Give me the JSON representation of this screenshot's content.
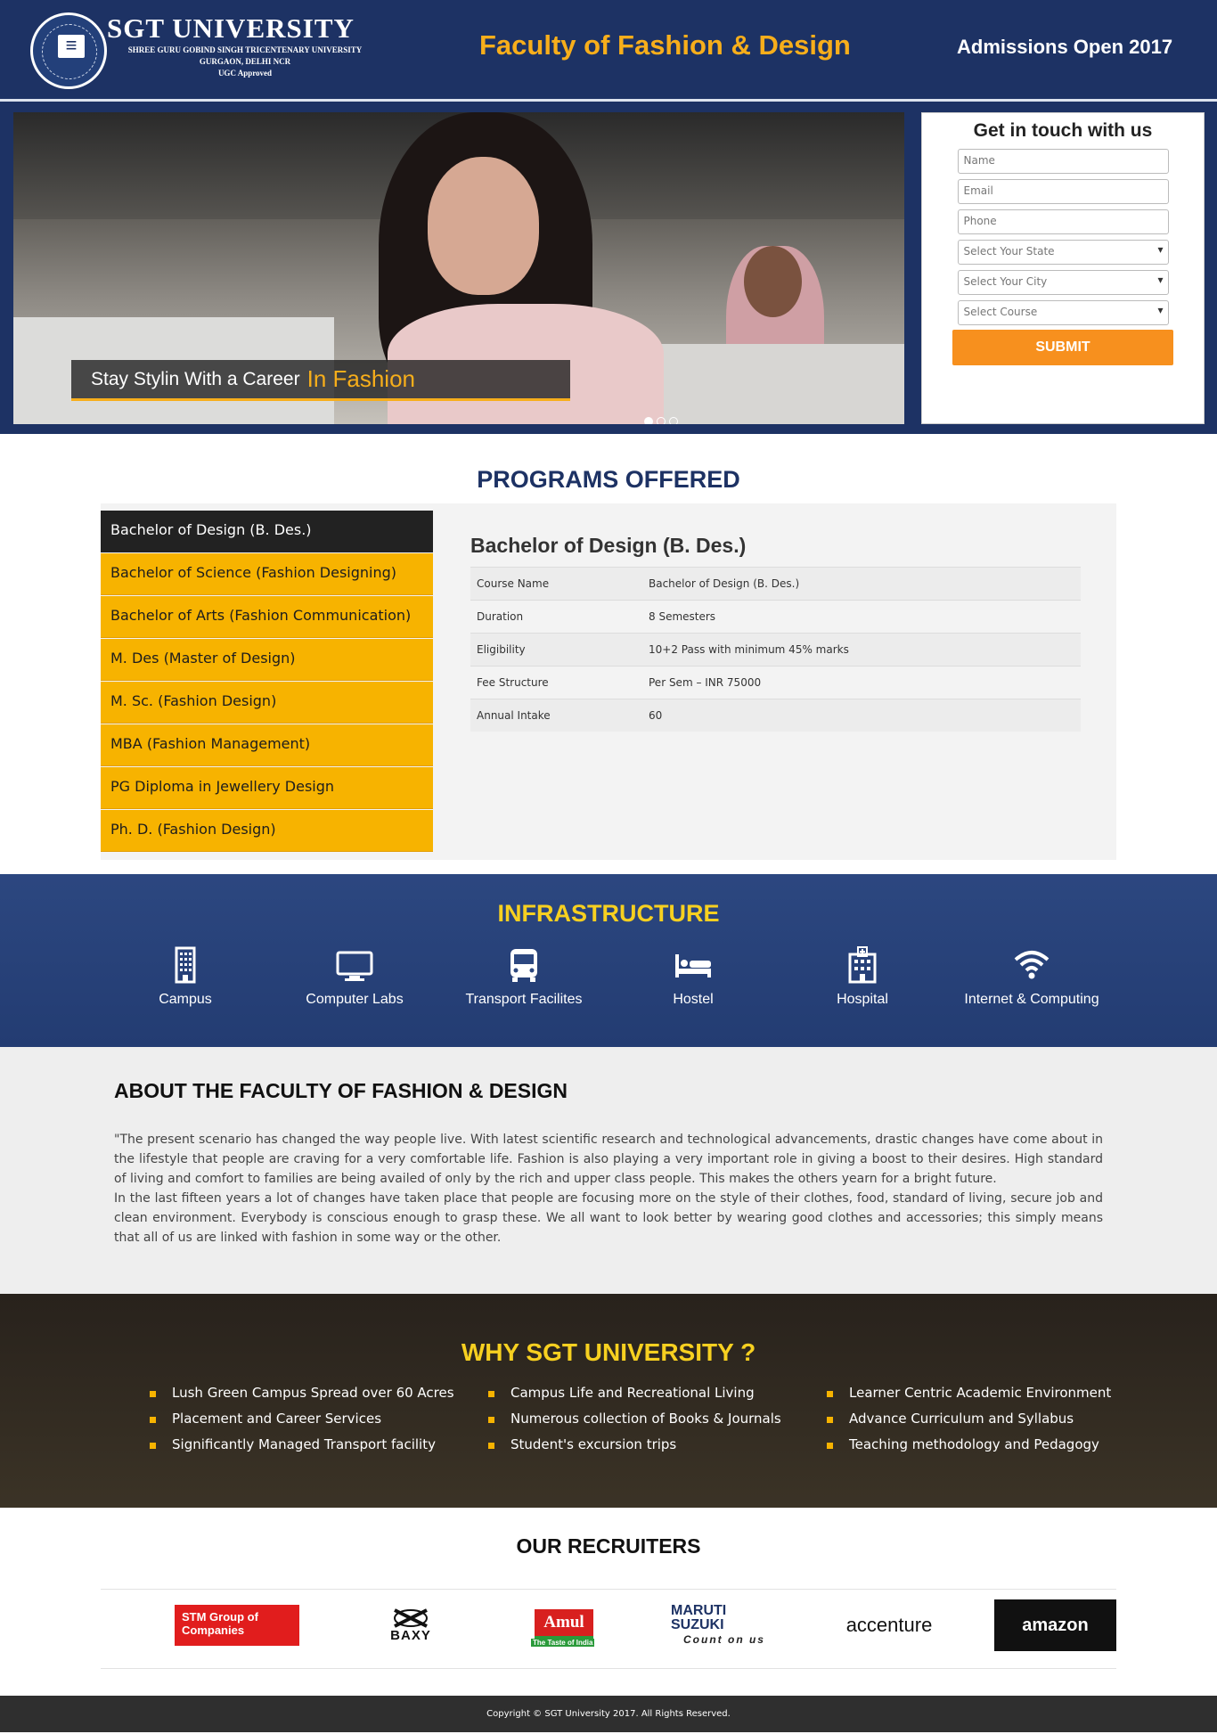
{
  "header": {
    "logo_title": "SGT UNIVERSITY",
    "logo_sub1": "SHREE GURU GOBIND SINGH TRICENTENARY UNIVERSITY",
    "logo_sub2": "GURGAON, DELHI NCR",
    "logo_sub3": "UGC Approved",
    "faculty_title": "Faculty of Fashion & Design",
    "admissions": "Admissions Open 2017"
  },
  "hero": {
    "caption_white": "Stay Stylin With a Career",
    "caption_gold": "In Fashion",
    "active_slide": 1,
    "slide_count": 3
  },
  "form": {
    "title": "Get in touch with us",
    "name_placeholder": "Name",
    "email_placeholder": "Email",
    "phone_placeholder": "Phone",
    "state_select": "Select Your State",
    "city_select": "Select Your City",
    "course_select": "Select Course",
    "submit_label": "SUBMIT"
  },
  "programs": {
    "title": "PROGRAMS OFFERED",
    "items": [
      "Bachelor of Design (B. Des.)",
      "Bachelor of Science (Fashion Designing)",
      "Bachelor of Arts (Fashion Communication)",
      "M. Des (Master of Design)",
      "M. Sc. (Fashion Design)",
      "MBA (Fashion Management)",
      "PG Diploma in Jewellery Design",
      "Ph. D. (Fashion Design)"
    ],
    "detail": {
      "title": "Bachelor of Design (B. Des.)",
      "rows": [
        {
          "k": "Course Name",
          "v": "Bachelor of Design (B. Des.)"
        },
        {
          "k": "Duration",
          "v": "8 Semesters"
        },
        {
          "k": "Eligibility",
          "v": "10+2 Pass with minimum 45% marks"
        },
        {
          "k": "Fee Structure",
          "v": "Per Sem – INR 75000"
        },
        {
          "k": "Annual Intake",
          "v": "60"
        }
      ]
    }
  },
  "infrastructure": {
    "title": "INFRASTRUCTURE",
    "items": [
      {
        "label": "Campus",
        "icon": "building-icon"
      },
      {
        "label": "Computer Labs",
        "icon": "monitor-icon"
      },
      {
        "label": "Transport Facilites",
        "icon": "bus-icon"
      },
      {
        "label": "Hostel",
        "icon": "bed-icon"
      },
      {
        "label": "Hospital",
        "icon": "hospital-icon"
      },
      {
        "label": "Internet & Computing",
        "icon": "wifi-icon"
      }
    ]
  },
  "about": {
    "title": "ABOUT THE FACULTY OF FASHION & DESIGN",
    "para1": "\"The present scenario has changed the way people live. With latest scientific research and technological advancements, drastic changes have come about in the lifestyle that people are craving for a very comfortable life. Fashion is also playing a very important role in giving a boost to their desires. High standard of living and comfort to families are being availed of only by the rich and upper class people. This makes the others yearn for a bright future.",
    "para2": "In the last fifteen years a lot of changes have taken place that people are focusing more on the style of their clothes, food, standard of living, secure job and clean environment. Everybody is conscious enough to grasp these. We all want to look better by wearing good clothes and accessories; this simply means that all of us are linked with fashion in some way or the other."
  },
  "why": {
    "title": "WHY SGT UNIVERSITY ?",
    "col1": [
      "Lush Green Campus Spread over 60 Acres",
      "Placement and Career Services",
      "Significantly Managed Transport facility"
    ],
    "col2": [
      "Campus Life and Recreational Living",
      "Numerous collection of Books & Journals",
      "Student's excursion trips"
    ],
    "col3": [
      "Learner Centric Academic Environment",
      "Advance Curriculum and Syllabus",
      "Teaching methodology and Pedagogy"
    ]
  },
  "recruiters": {
    "title": "OUR RECRUITERS",
    "logos": {
      "stm": "STM Group of Companies",
      "baxy": "BAXY",
      "amul": "Amul",
      "amul_tag": "The Taste of India",
      "maruti": "MARUTI SUZUKI",
      "maruti_tag": "Count on us",
      "accenture": "accenture",
      "amazon": "amazon"
    }
  },
  "footer": {
    "copyright": "Copyright © SGT University 2017. All Rights Reserved."
  },
  "colors": {
    "navy": "#1d3264",
    "gold": "#f7ae1b",
    "program_item": "#f7b300",
    "submit": "#f7901e"
  }
}
